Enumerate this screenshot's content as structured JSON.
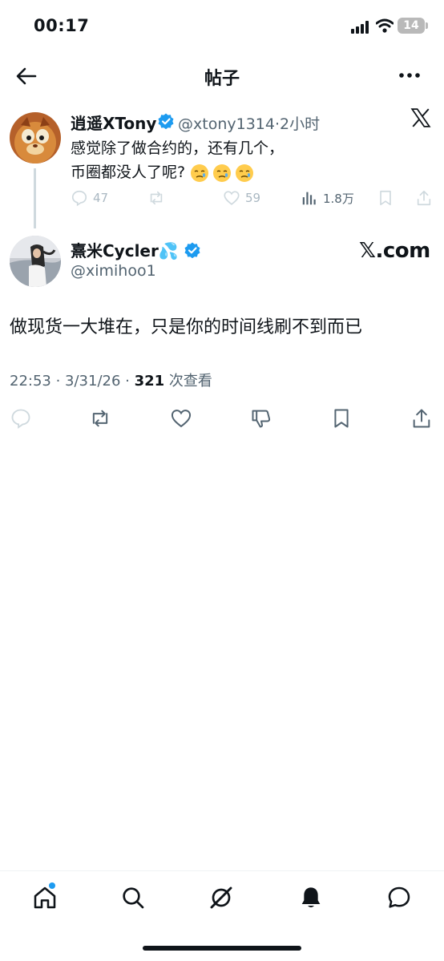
{
  "status_bar": {
    "time": "00:17",
    "battery": "14"
  },
  "header": {
    "title": "帖子",
    "back_icon": "arrow-left-icon",
    "more_icon": "more-horizontal-icon"
  },
  "quoted_tweet": {
    "display_name": "逍遥XTony",
    "handle": "@xtony1314",
    "separator": "·",
    "time_ago": "2小时",
    "text_line1": "感觉除了做合约的，还有几个，",
    "text_line2": "币圈都没人了呢?",
    "emojis": [
      "crying-face-emoji",
      "crying-face-emoji",
      "crying-face-emoji"
    ],
    "actions": {
      "replies": "47",
      "reposts": "",
      "likes": "59",
      "views": "1.8万"
    }
  },
  "main_tweet": {
    "display_name": "熹米Cycler💦",
    "handle": "@ximihoo1",
    "watermark": "𝕏.com",
    "text": "做现货一大堆在，只是你的时间线刷不到而已",
    "timestamp": "22:53 · 3/31/26 ·",
    "views_count": "321",
    "views_label": " 次查看"
  },
  "colors": {
    "accent": "#1d9bf0",
    "text": "#0f1419",
    "secondary": "#536471",
    "muted": "#cfd9de"
  },
  "bottom_nav": [
    "home-icon",
    "search-icon",
    "grok-icon",
    "notifications-bell-icon",
    "messages-icon"
  ]
}
